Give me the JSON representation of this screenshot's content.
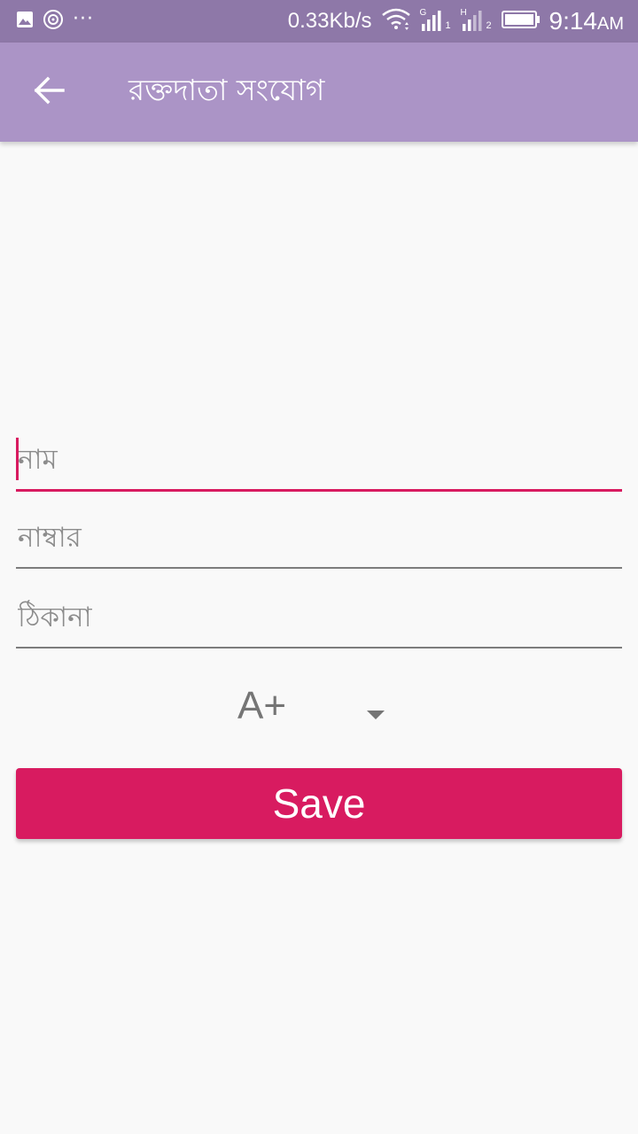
{
  "status_bar": {
    "net_speed": "0.33Kb/s",
    "time": "9:14",
    "ampm": "AM",
    "overflow": "···",
    "sim1_type": "G",
    "sim1_index": "1",
    "sim2_type": "H",
    "sim2_index": "2",
    "icons": [
      "image-notification-icon",
      "sync-notification-icon",
      "more-notifications-icon",
      "wifi-icon",
      "signal-sim1-icon",
      "signal-sim2-icon",
      "battery-icon"
    ]
  },
  "app_bar": {
    "title": "রক্তদাতা  সংযোগ",
    "back_icon": "arrow-back-icon",
    "background": "#ab94c6"
  },
  "form": {
    "name_placeholder": "নাম",
    "number_placeholder": "নাম্বার",
    "address_placeholder": "ঠিকানা",
    "blood_group_selected": "A+",
    "save_label": "Save"
  },
  "colors": {
    "accent": "#d81b60",
    "status_bar": "#8e78a8",
    "app_bar": "#ab94c6"
  }
}
